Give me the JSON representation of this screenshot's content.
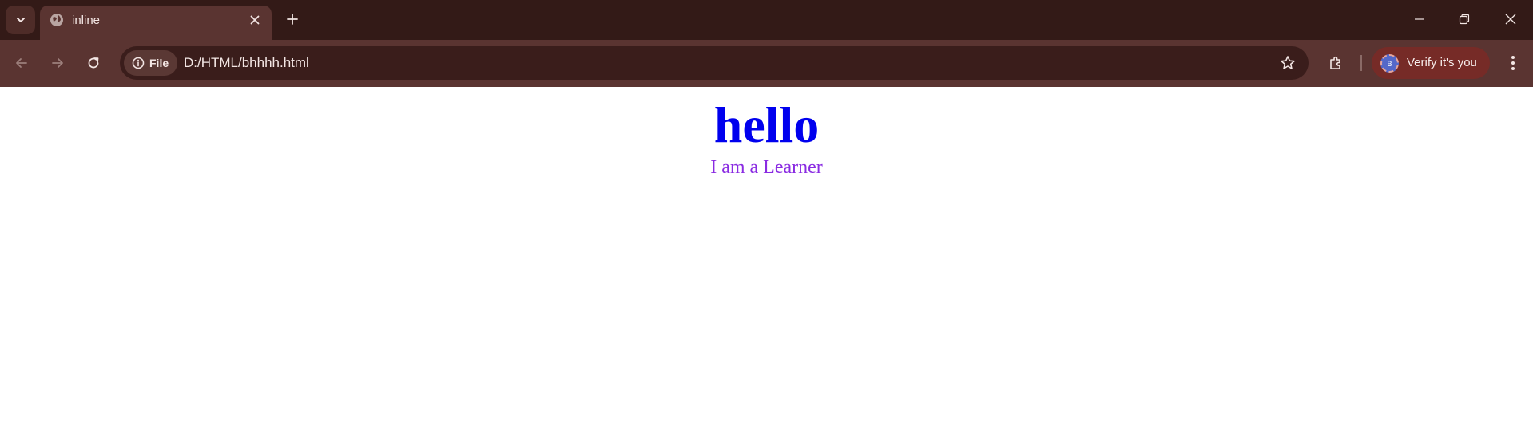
{
  "browser": {
    "tab": {
      "title": "inline"
    },
    "address_bar": {
      "chip_label": "File",
      "url": "D:/HTML/bhhhh.html"
    },
    "profile": {
      "label": "Verify it's you",
      "avatar_initial": "B"
    }
  },
  "page": {
    "heading": "hello",
    "subtext": "I am a Learner"
  }
}
